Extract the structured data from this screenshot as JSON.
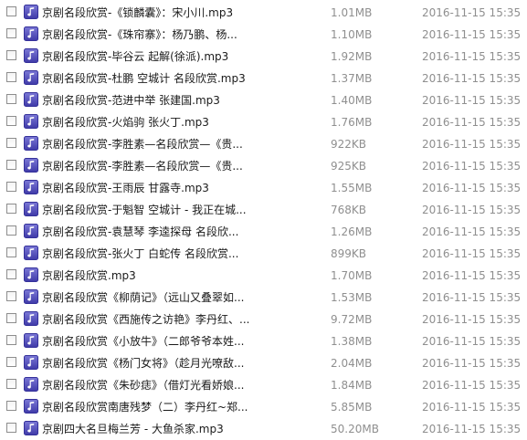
{
  "file_icon": "music-note-file-icon",
  "colors": {
    "icon_gradient_top": "#7b78d6",
    "icon_gradient_bottom": "#3f3aa8",
    "name_text": "#1a1a1a",
    "meta_text": "#8f8f8f"
  },
  "files": [
    {
      "name": "京剧名段欣赏-《锁麟囊》：宋小川.mp3",
      "size": "1.01MB",
      "date": "2016-11-15 15:35"
    },
    {
      "name": "京剧名段欣赏-《珠帘寨》：杨乃鹏、杨...",
      "size": "1.10MB",
      "date": "2016-11-15 15:35"
    },
    {
      "name": "京剧名段欣赏-毕谷云  起解(徐派).mp3",
      "size": "1.92MB",
      "date": "2016-11-15 15:35"
    },
    {
      "name": "京剧名段欣赏-杜鹏 空城计 名段欣赏.mp3",
      "size": "1.37MB",
      "date": "2016-11-15 15:35"
    },
    {
      "name": "京剧名段欣赏-范进中举 张建国.mp3",
      "size": "1.40MB",
      "date": "2016-11-15 15:35"
    },
    {
      "name": "京剧名段欣赏-火焰驹 张火丁.mp3",
      "size": "1.76MB",
      "date": "2016-11-15 15:35"
    },
    {
      "name": "京剧名段欣赏-李胜素—名段欣赏—《贵...",
      "size": "922KB",
      "date": "2016-11-15 15:35"
    },
    {
      "name": "京剧名段欣赏-李胜素—名段欣赏—《贵...",
      "size": "925KB",
      "date": "2016-11-15 15:35"
    },
    {
      "name": "京剧名段欣赏-王雨辰 甘露寺.mp3",
      "size": "1.55MB",
      "date": "2016-11-15 15:35"
    },
    {
      "name": "京剧名段欣赏-于魁智 空城计 - 我正在城...",
      "size": "768KB",
      "date": "2016-11-15 15:35"
    },
    {
      "name": "京剧名段欣赏-袁慧琴 李逵探母 名段欣...",
      "size": "1.26MB",
      "date": "2016-11-15 15:35"
    },
    {
      "name": "京剧名段欣赏-张火丁  白蛇传 名段欣赏...",
      "size": "899KB",
      "date": "2016-11-15 15:35"
    },
    {
      "name": "京剧名段欣赏.mp3",
      "size": "1.70MB",
      "date": "2016-11-15 15:35"
    },
    {
      "name": "京剧名段欣赏《柳荫记》（远山又叠翠如...",
      "size": "1.53MB",
      "date": "2016-11-15 15:35"
    },
    {
      "name": "京剧名段欣赏《西施传之访艳》李丹红、...",
      "size": "9.72MB",
      "date": "2016-11-15 15:35"
    },
    {
      "name": "京剧名段欣赏《小放牛》（二郎爷爷本姓...",
      "size": "1.38MB",
      "date": "2016-11-15 15:35"
    },
    {
      "name": "京剧名段欣赏《杨门女将》（趁月光嘹敌...",
      "size": "2.04MB",
      "date": "2016-11-15 15:35"
    },
    {
      "name": "京剧名段欣赏《朱砂痣》（借灯光看娇娘...",
      "size": "1.84MB",
      "date": "2016-11-15 15:35"
    },
    {
      "name": "京剧名段欣赏南唐残梦（二）李丹红~郑...",
      "size": "5.85MB",
      "date": "2016-11-15 15:35"
    },
    {
      "name": "京剧四大名旦梅兰芳 - 大鱼杀家.mp3",
      "size": "50.20MB",
      "date": "2016-11-15 15:35"
    }
  ]
}
